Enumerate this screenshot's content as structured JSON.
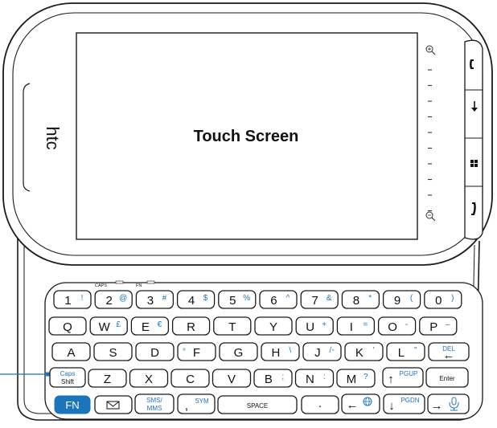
{
  "screen": {
    "label": "Touch Screen"
  },
  "brand": "htc",
  "indicators": {
    "caps": "CAPS",
    "fn": "FN"
  },
  "colors": {
    "accent": "#1b75bc",
    "outline": "#1a1a1a"
  },
  "side_buttons": [
    {
      "name": "call-button",
      "icon": "phone-icon"
    },
    {
      "name": "down-button",
      "icon": "arrow-down-icon"
    },
    {
      "name": "windows-button",
      "icon": "windows-icon"
    },
    {
      "name": "end-call-button",
      "icon": "end-call-icon"
    }
  ],
  "zoom": {
    "in_icon": "zoom-in-icon",
    "out_icon": "zoom-out-icon"
  },
  "keyboard": {
    "row1": [
      {
        "main": "1",
        "alt": "!"
      },
      {
        "main": "2",
        "alt": "@"
      },
      {
        "main": "3",
        "alt": "#"
      },
      {
        "main": "4",
        "alt": "$"
      },
      {
        "main": "5",
        "alt": "%"
      },
      {
        "main": "6",
        "alt": "^"
      },
      {
        "main": "7",
        "alt": "&"
      },
      {
        "main": "8",
        "alt": "*"
      },
      {
        "main": "9",
        "alt": "("
      },
      {
        "main": "0",
        "alt": ")"
      }
    ],
    "row2": [
      {
        "main": "Q",
        "alt": ""
      },
      {
        "main": "W",
        "alt": "£"
      },
      {
        "main": "E",
        "alt": "€"
      },
      {
        "main": "R",
        "alt": ""
      },
      {
        "main": "T",
        "alt": ""
      },
      {
        "main": "Y",
        "alt": ""
      },
      {
        "main": "U",
        "alt": "+"
      },
      {
        "main": "I",
        "alt": "="
      },
      {
        "main": "O",
        "alt": "-"
      },
      {
        "main": "P",
        "alt": "–"
      }
    ],
    "row3": [
      {
        "main": "A",
        "alt": ""
      },
      {
        "main": "S",
        "alt": ""
      },
      {
        "main": "D",
        "alt": ""
      },
      {
        "main": "F",
        "alt": "",
        "pre": "°"
      },
      {
        "main": "G",
        "alt": ""
      },
      {
        "main": "H",
        "alt": "\\"
      },
      {
        "main": "J",
        "alt": "/◦"
      },
      {
        "main": "K",
        "alt": "'"
      },
      {
        "main": "L",
        "alt": "\""
      }
    ],
    "del": {
      "top": "DEL",
      "arrow": "←"
    },
    "row4": [
      {
        "main": "Z",
        "alt": ""
      },
      {
        "main": "X",
        "alt": ""
      },
      {
        "main": "C",
        "alt": ""
      },
      {
        "main": "V",
        "alt": ""
      },
      {
        "main": "B",
        "alt": ";"
      },
      {
        "main": "N",
        "alt": ":"
      },
      {
        "main": "M",
        "alt": "?"
      }
    ],
    "caps_shift": {
      "top": "Caps",
      "bottom": "Shift"
    },
    "pgup": {
      "arrow": "↑",
      "label": "PGUP"
    },
    "enter": "Enter",
    "fn": "FN",
    "mail_icon": "envelope-icon",
    "sms": {
      "top": "SMS/",
      "bottom": "MMS"
    },
    "sym": {
      "main": ",",
      "alt": "SYM"
    },
    "space": "SPACE",
    "dot": ".",
    "globe": {
      "arrow": "←",
      "icon": "globe-icon"
    },
    "pgdn": {
      "arrow": "↓",
      "label": "PGDN"
    },
    "mic": {
      "arrow": "→",
      "icon": "microphone-icon"
    }
  }
}
